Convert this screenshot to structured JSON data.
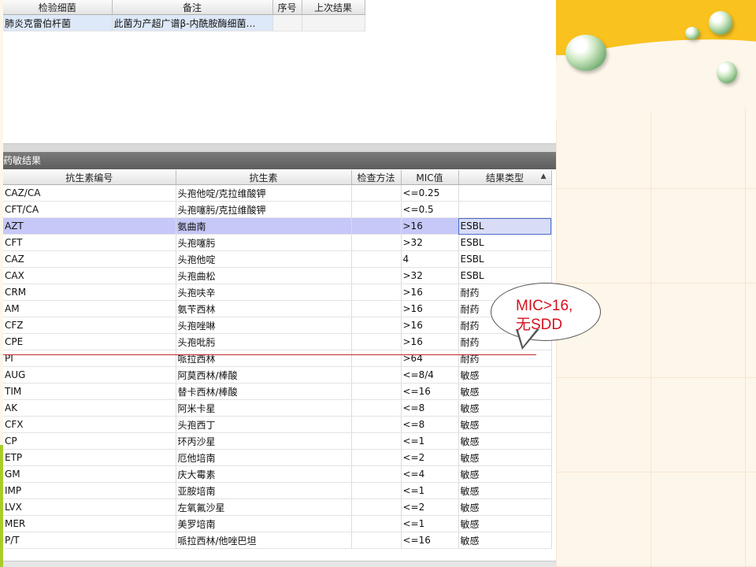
{
  "bacteria_grid": {
    "columns": [
      "检验细菌",
      "备注",
      "序号",
      "上次结果"
    ],
    "rows": [
      [
        "肺炎克雷伯杆菌",
        "此菌为产超广谱β-内酰胺酶细菌…",
        "",
        ""
      ]
    ]
  },
  "drug_section": {
    "title": "药敏结果",
    "columns": [
      "抗生素编号",
      "抗生素",
      "检查方法",
      "MIC值",
      "结果类型"
    ],
    "sort_indicator": "▲",
    "rows": [
      [
        "CAZ/CA",
        "头孢他啶/克拉维酸钾",
        "",
        "<=0.25",
        ""
      ],
      [
        "CFT/CA",
        "头孢噻肟/克拉维酸钾",
        "",
        "<=0.5",
        ""
      ],
      [
        "AZT",
        "氨曲南",
        "",
        ">16",
        "ESBL"
      ],
      [
        "CFT",
        "头孢噻肟",
        "",
        ">32",
        "ESBL"
      ],
      [
        "CAZ",
        "头孢他啶",
        "",
        "4",
        "ESBL"
      ],
      [
        "CAX",
        "头孢曲松",
        "",
        ">32",
        "ESBL"
      ],
      [
        "CRM",
        "头孢呋辛",
        "",
        ">16",
        "耐药"
      ],
      [
        "AM",
        "氨苄西林",
        "",
        ">16",
        "耐药"
      ],
      [
        "CFZ",
        "头孢唑啉",
        "",
        ">16",
        "耐药"
      ],
      [
        "CPE",
        "头孢吡肟",
        "",
        ">16",
        "耐药"
      ],
      [
        "PI",
        "哌拉西林",
        "",
        ">64",
        "耐药"
      ],
      [
        "AUG",
        "阿莫西林/棒酸",
        "",
        "<=8/4",
        "敏感"
      ],
      [
        "TIM",
        "替卡西林/棒酸",
        "",
        "<=16",
        "敏感"
      ],
      [
        "AK",
        "阿米卡星",
        "",
        "<=8",
        "敏感"
      ],
      [
        "CFX",
        "头孢西丁",
        "",
        "<=8",
        "敏感"
      ],
      [
        "CP",
        "环丙沙星",
        "",
        "<=1",
        "敏感"
      ],
      [
        "ETP",
        "厄他培南",
        "",
        "<=2",
        "敏感"
      ],
      [
        "GM",
        "庆大霉素",
        "",
        "<=4",
        "敏感"
      ],
      [
        "IMP",
        "亚胺培南",
        "",
        "<=1",
        "敏感"
      ],
      [
        "LVX",
        "左氧氟沙星",
        "",
        "<=2",
        "敏感"
      ],
      [
        "MER",
        "美罗培南",
        "",
        "<=1",
        "敏感"
      ],
      [
        "P/T",
        "哌拉西林/他唑巴坦",
        "",
        "<=16",
        "敏感"
      ]
    ],
    "selected_row": "AZT"
  },
  "annotation": {
    "line1": "MIC>16,",
    "line2": "无SDD"
  },
  "colors": {
    "selection": "#c6c8f8",
    "header_bar": "#6a6a6a",
    "annotation_text": "#d4121e",
    "slide_yellow": "#f9c21e",
    "slide_accent": "#a9cc2a"
  }
}
